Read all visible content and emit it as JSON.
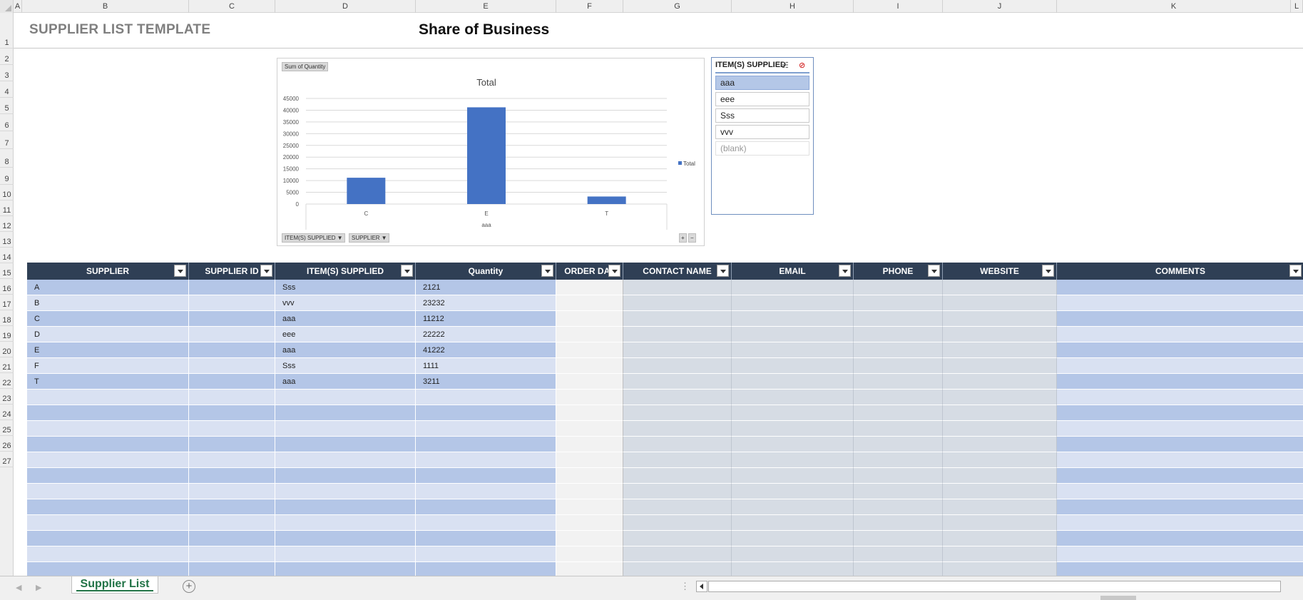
{
  "columns": [
    "A",
    "B",
    "C",
    "D",
    "E",
    "F",
    "G",
    "H",
    "I",
    "J",
    "K",
    "L"
  ],
  "rows": [
    "1",
    "2",
    "3",
    "4",
    "5",
    "6",
    "7",
    "8",
    "9",
    "10",
    "11",
    "12",
    "13",
    "14",
    "15",
    "16",
    "17",
    "18",
    "19",
    "20",
    "21",
    "22",
    "23",
    "24",
    "25",
    "26",
    "27"
  ],
  "sheet": {
    "title": "SUPPLIER LIST TEMPLATE",
    "subtitle": "Share of Business"
  },
  "pivot_buttons": {
    "value_field": "Sum of Quantity",
    "axis_field": "ITEM(S) SUPPLIED",
    "legend_field": "SUPPLIER",
    "expand": "+",
    "collapse": "−"
  },
  "chart_data": {
    "type": "bar",
    "title": "Total",
    "categories": [
      "C",
      "E",
      "T"
    ],
    "series": [
      {
        "name": "Total",
        "values": [
          11212,
          41222,
          3211
        ]
      }
    ],
    "xlabel": "aaa",
    "ylim": [
      0,
      45000
    ],
    "yticks": [
      "0",
      "5000",
      "10000",
      "15000",
      "20000",
      "25000",
      "30000",
      "35000",
      "40000",
      "45000"
    ],
    "grid": true,
    "legend_position": "right",
    "bar_color": "#4472c4"
  },
  "slicer": {
    "title": "ITEM(S) SUPPLIED",
    "items": [
      {
        "label": "aaa",
        "state": "selected"
      },
      {
        "label": "eee",
        "state": "normal"
      },
      {
        "label": "Sss",
        "state": "normal"
      },
      {
        "label": "vvv",
        "state": "normal"
      },
      {
        "label": "(blank)",
        "state": "blank"
      }
    ]
  },
  "table": {
    "headers": [
      "SUPPLIER",
      "SUPPLIER ID",
      "ITEM(S) SUPPLIED",
      "Quantity",
      "ORDER DAT",
      "CONTACT NAME",
      "EMAIL",
      "PHONE",
      "WEBSITE",
      "COMMENTS"
    ],
    "rows": [
      [
        "A",
        "",
        "Sss",
        "2121",
        "",
        "",
        "",
        "",
        "",
        ""
      ],
      [
        "B",
        "",
        "vvv",
        "23232",
        "",
        "",
        "",
        "",
        "",
        ""
      ],
      [
        "C",
        "",
        "aaa",
        "11212",
        "",
        "",
        "",
        "",
        "",
        ""
      ],
      [
        "D",
        "",
        "eee",
        "22222",
        "",
        "",
        "",
        "",
        "",
        ""
      ],
      [
        "E",
        "",
        "aaa",
        "41222",
        "",
        "",
        "",
        "",
        "",
        ""
      ],
      [
        "F",
        "",
        "Sss",
        "1111",
        "",
        "",
        "",
        "",
        "",
        ""
      ],
      [
        "T",
        "",
        "aaa",
        "3211",
        "",
        "",
        "",
        "",
        "",
        ""
      ]
    ],
    "empty_rows": 12,
    "colors": {
      "band_dark": "#b4c6e7",
      "band_light": "#d9e1f2",
      "order_col": "#f2f2f2",
      "contact_cols": "#d6dce4"
    }
  },
  "tabs": {
    "active": "Supplier List",
    "add_label": "+"
  }
}
